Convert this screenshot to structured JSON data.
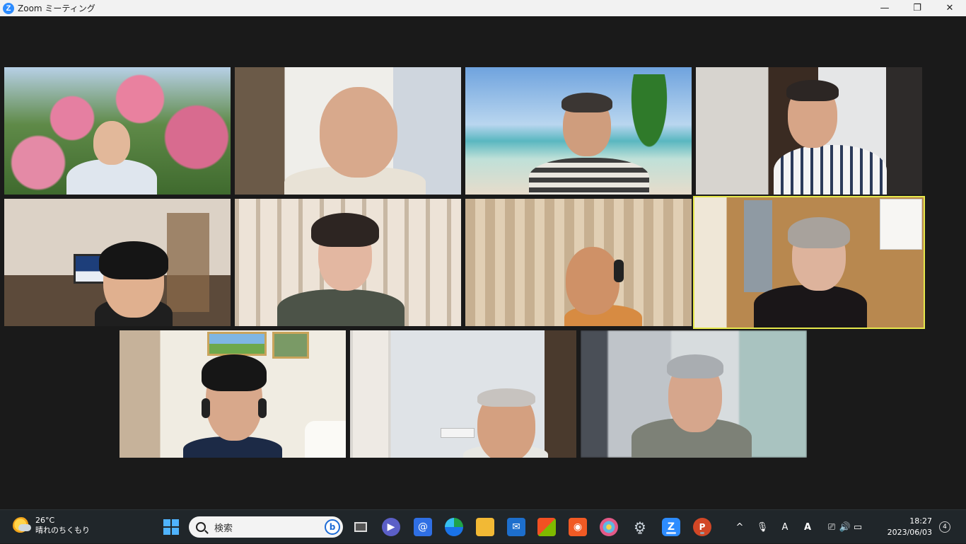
{
  "window": {
    "title": "Zoom ミーティング",
    "minimize_glyph": "—",
    "maximize_glyph": "❐",
    "close_glyph": "✕"
  },
  "gallery": {
    "participants": [
      {
        "id": "p1",
        "background": "garden-roses"
      },
      {
        "id": "p2",
        "background": "room-window"
      },
      {
        "id": "p3",
        "background": "beach-palm"
      },
      {
        "id": "p4",
        "background": "office-shelves"
      },
      {
        "id": "p5",
        "background": "living-room-painting"
      },
      {
        "id": "p6",
        "background": "shoji-screen"
      },
      {
        "id": "p7",
        "background": "curtain"
      },
      {
        "id": "p8",
        "background": "wooden-door-calendar",
        "active_speaker": true
      },
      {
        "id": "p9",
        "background": "room-pictures"
      },
      {
        "id": "p10",
        "background": "white-room-curtain"
      },
      {
        "id": "p11",
        "background": "blurred-room"
      }
    ]
  },
  "taskbar": {
    "weather": {
      "temp": "26°C",
      "condition": "晴れのちくもり",
      "icon": "partly-cloudy-icon"
    },
    "search_placeholder": "検索",
    "bing_glyph": "b",
    "clock": {
      "time": "18:27",
      "date": "2023/06/03"
    },
    "notification_count": "4",
    "tray_glyphs": {
      "chevron": "^",
      "mic": "🎙",
      "ime": "A",
      "adobe": "A",
      "display": "⎚",
      "speaker": "🔊",
      "battery": "▭"
    }
  },
  "colors": {
    "zoom_blue": "#2d8cff",
    "active_speaker_outline": "#e6e84b",
    "taskbar_bg": "#20262a"
  }
}
